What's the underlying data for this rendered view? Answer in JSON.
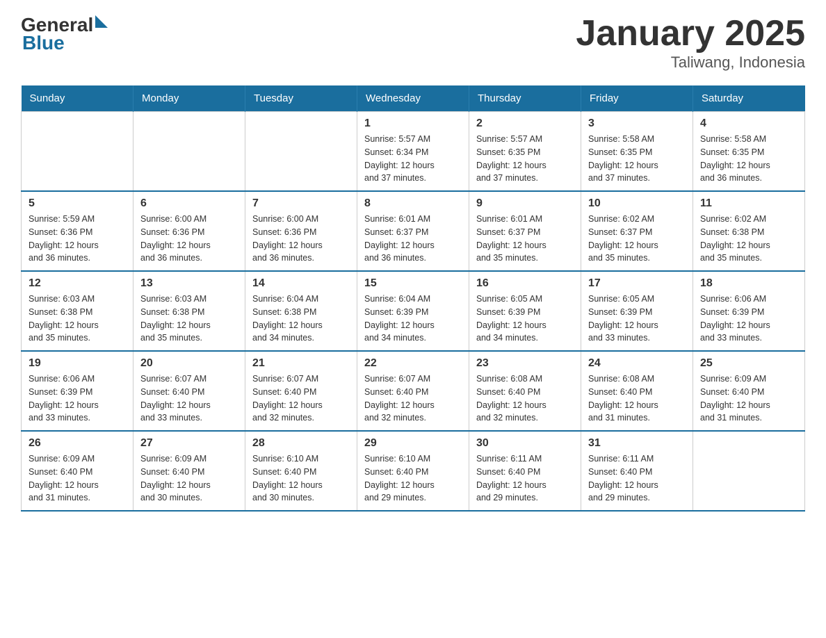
{
  "header": {
    "logo_general": "General",
    "logo_blue": "Blue",
    "title": "January 2025",
    "subtitle": "Taliwang, Indonesia"
  },
  "days_of_week": [
    "Sunday",
    "Monday",
    "Tuesday",
    "Wednesday",
    "Thursday",
    "Friday",
    "Saturday"
  ],
  "weeks": [
    {
      "days": [
        {
          "number": "",
          "info": ""
        },
        {
          "number": "",
          "info": ""
        },
        {
          "number": "",
          "info": ""
        },
        {
          "number": "1",
          "info": "Sunrise: 5:57 AM\nSunset: 6:34 PM\nDaylight: 12 hours\nand 37 minutes."
        },
        {
          "number": "2",
          "info": "Sunrise: 5:57 AM\nSunset: 6:35 PM\nDaylight: 12 hours\nand 37 minutes."
        },
        {
          "number": "3",
          "info": "Sunrise: 5:58 AM\nSunset: 6:35 PM\nDaylight: 12 hours\nand 37 minutes."
        },
        {
          "number": "4",
          "info": "Sunrise: 5:58 AM\nSunset: 6:35 PM\nDaylight: 12 hours\nand 36 minutes."
        }
      ]
    },
    {
      "days": [
        {
          "number": "5",
          "info": "Sunrise: 5:59 AM\nSunset: 6:36 PM\nDaylight: 12 hours\nand 36 minutes."
        },
        {
          "number": "6",
          "info": "Sunrise: 6:00 AM\nSunset: 6:36 PM\nDaylight: 12 hours\nand 36 minutes."
        },
        {
          "number": "7",
          "info": "Sunrise: 6:00 AM\nSunset: 6:36 PM\nDaylight: 12 hours\nand 36 minutes."
        },
        {
          "number": "8",
          "info": "Sunrise: 6:01 AM\nSunset: 6:37 PM\nDaylight: 12 hours\nand 36 minutes."
        },
        {
          "number": "9",
          "info": "Sunrise: 6:01 AM\nSunset: 6:37 PM\nDaylight: 12 hours\nand 35 minutes."
        },
        {
          "number": "10",
          "info": "Sunrise: 6:02 AM\nSunset: 6:37 PM\nDaylight: 12 hours\nand 35 minutes."
        },
        {
          "number": "11",
          "info": "Sunrise: 6:02 AM\nSunset: 6:38 PM\nDaylight: 12 hours\nand 35 minutes."
        }
      ]
    },
    {
      "days": [
        {
          "number": "12",
          "info": "Sunrise: 6:03 AM\nSunset: 6:38 PM\nDaylight: 12 hours\nand 35 minutes."
        },
        {
          "number": "13",
          "info": "Sunrise: 6:03 AM\nSunset: 6:38 PM\nDaylight: 12 hours\nand 35 minutes."
        },
        {
          "number": "14",
          "info": "Sunrise: 6:04 AM\nSunset: 6:38 PM\nDaylight: 12 hours\nand 34 minutes."
        },
        {
          "number": "15",
          "info": "Sunrise: 6:04 AM\nSunset: 6:39 PM\nDaylight: 12 hours\nand 34 minutes."
        },
        {
          "number": "16",
          "info": "Sunrise: 6:05 AM\nSunset: 6:39 PM\nDaylight: 12 hours\nand 34 minutes."
        },
        {
          "number": "17",
          "info": "Sunrise: 6:05 AM\nSunset: 6:39 PM\nDaylight: 12 hours\nand 33 minutes."
        },
        {
          "number": "18",
          "info": "Sunrise: 6:06 AM\nSunset: 6:39 PM\nDaylight: 12 hours\nand 33 minutes."
        }
      ]
    },
    {
      "days": [
        {
          "number": "19",
          "info": "Sunrise: 6:06 AM\nSunset: 6:39 PM\nDaylight: 12 hours\nand 33 minutes."
        },
        {
          "number": "20",
          "info": "Sunrise: 6:07 AM\nSunset: 6:40 PM\nDaylight: 12 hours\nand 33 minutes."
        },
        {
          "number": "21",
          "info": "Sunrise: 6:07 AM\nSunset: 6:40 PM\nDaylight: 12 hours\nand 32 minutes."
        },
        {
          "number": "22",
          "info": "Sunrise: 6:07 AM\nSunset: 6:40 PM\nDaylight: 12 hours\nand 32 minutes."
        },
        {
          "number": "23",
          "info": "Sunrise: 6:08 AM\nSunset: 6:40 PM\nDaylight: 12 hours\nand 32 minutes."
        },
        {
          "number": "24",
          "info": "Sunrise: 6:08 AM\nSunset: 6:40 PM\nDaylight: 12 hours\nand 31 minutes."
        },
        {
          "number": "25",
          "info": "Sunrise: 6:09 AM\nSunset: 6:40 PM\nDaylight: 12 hours\nand 31 minutes."
        }
      ]
    },
    {
      "days": [
        {
          "number": "26",
          "info": "Sunrise: 6:09 AM\nSunset: 6:40 PM\nDaylight: 12 hours\nand 31 minutes."
        },
        {
          "number": "27",
          "info": "Sunrise: 6:09 AM\nSunset: 6:40 PM\nDaylight: 12 hours\nand 30 minutes."
        },
        {
          "number": "28",
          "info": "Sunrise: 6:10 AM\nSunset: 6:40 PM\nDaylight: 12 hours\nand 30 minutes."
        },
        {
          "number": "29",
          "info": "Sunrise: 6:10 AM\nSunset: 6:40 PM\nDaylight: 12 hours\nand 29 minutes."
        },
        {
          "number": "30",
          "info": "Sunrise: 6:11 AM\nSunset: 6:40 PM\nDaylight: 12 hours\nand 29 minutes."
        },
        {
          "number": "31",
          "info": "Sunrise: 6:11 AM\nSunset: 6:40 PM\nDaylight: 12 hours\nand 29 minutes."
        },
        {
          "number": "",
          "info": ""
        }
      ]
    }
  ]
}
